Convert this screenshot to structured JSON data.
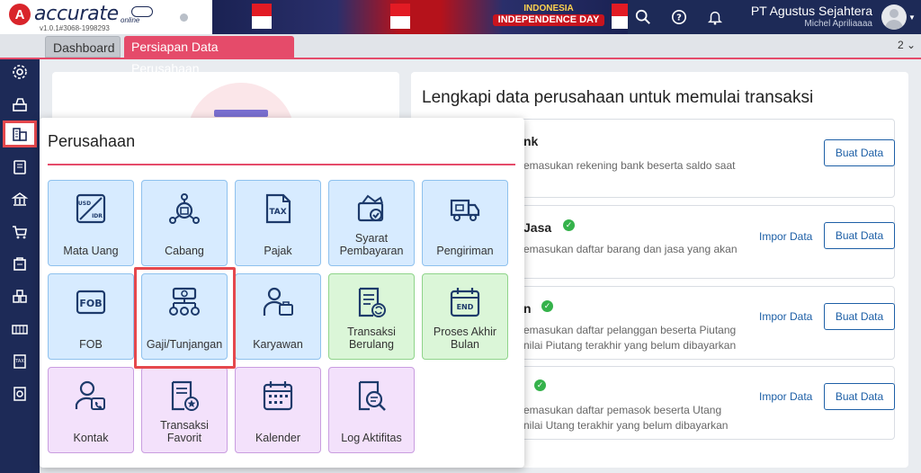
{
  "app": {
    "logo_text": "accurate",
    "logo_sub": "online",
    "version": "v1.0.1#3068-1998293",
    "banner_line1": "INDONESIA",
    "banner_line2": "INDEPENDENCE DAY"
  },
  "topbar": {
    "company": "PT Agustus Sejahtera",
    "user": "Michel Apriliaaaa",
    "icons": [
      "search-icon",
      "help-icon",
      "bell-icon"
    ]
  },
  "tabs": {
    "dashboard": "Dashboard",
    "persiapan": "Persiapan Data Perusahaan",
    "count": "2 ⌄"
  },
  "sidebar": {
    "items": [
      "settings-icon",
      "cash-register-icon",
      "company-icon",
      "ledger-icon",
      "bank-icon",
      "cart-icon",
      "sales-icon",
      "inventory-icon",
      "warehouse-icon",
      "tax-icon",
      "report-icon"
    ],
    "active_index": 2
  },
  "main": {
    "title": "Lengkapi data perusahaan untuk memulai transaksi",
    "rows": [
      {
        "title": "nk",
        "desc": "emasukan rekening bank beserta saldo saat",
        "desc2": "",
        "checked": false,
        "impor": "",
        "buat": "Buat Data"
      },
      {
        "title": "Jasa",
        "desc": "emasukan daftar barang dan jasa yang akan",
        "desc2": "",
        "checked": true,
        "impor": "Impor Data",
        "buat": "Buat Data"
      },
      {
        "title": "n",
        "desc": "emasukan daftar pelanggan beserta Piutang",
        "desc2": "nilai Piutang terakhir yang belum dibayarkan",
        "checked": true,
        "impor": "Impor Data",
        "buat": "Buat Data"
      },
      {
        "title": "",
        "desc": "emasukan daftar pemasok beserta Utang",
        "desc2": "nilai Utang terakhir yang belum dibayarkan",
        "checked": true,
        "impor": "Impor Data",
        "buat": "Buat Data"
      }
    ]
  },
  "popup": {
    "title": "Perusahaan",
    "tiles": [
      {
        "label": "Mata Uang",
        "color": "blue",
        "icon": "currency-icon"
      },
      {
        "label": "Cabang",
        "color": "blue",
        "icon": "branch-icon"
      },
      {
        "label": "Pajak",
        "color": "blue",
        "icon": "tax-icon"
      },
      {
        "label": "Syarat Pembayaran",
        "color": "blue",
        "icon": "payment-terms-icon"
      },
      {
        "label": "Pengiriman",
        "color": "blue",
        "icon": "truck-icon"
      },
      {
        "label": "FOB",
        "color": "blue",
        "icon": "fob-icon"
      },
      {
        "label": "Gaji/Tunjangan",
        "color": "blue",
        "icon": "salary-icon"
      },
      {
        "label": "Karyawan",
        "color": "blue",
        "icon": "employee-icon"
      },
      {
        "label": "Transaksi Berulang",
        "color": "green",
        "icon": "recurring-icon"
      },
      {
        "label": "Proses Akhir Bulan",
        "color": "green",
        "icon": "month-end-icon"
      },
      {
        "label": "Kontak",
        "color": "purple",
        "icon": "contact-icon"
      },
      {
        "label": "Transaksi Favorit",
        "color": "purple",
        "icon": "favorite-icon"
      },
      {
        "label": "Kalender",
        "color": "purple",
        "icon": "calendar-icon"
      },
      {
        "label": "Log Aktifitas",
        "color": "purple",
        "icon": "activity-log-icon"
      }
    ],
    "highlighted": "Gaji/Tunjangan"
  },
  "colors": {
    "navy": "#1d2a57",
    "accent": "#e54b6a",
    "highlight": "#e5484d",
    "link": "#1d5fa6"
  }
}
